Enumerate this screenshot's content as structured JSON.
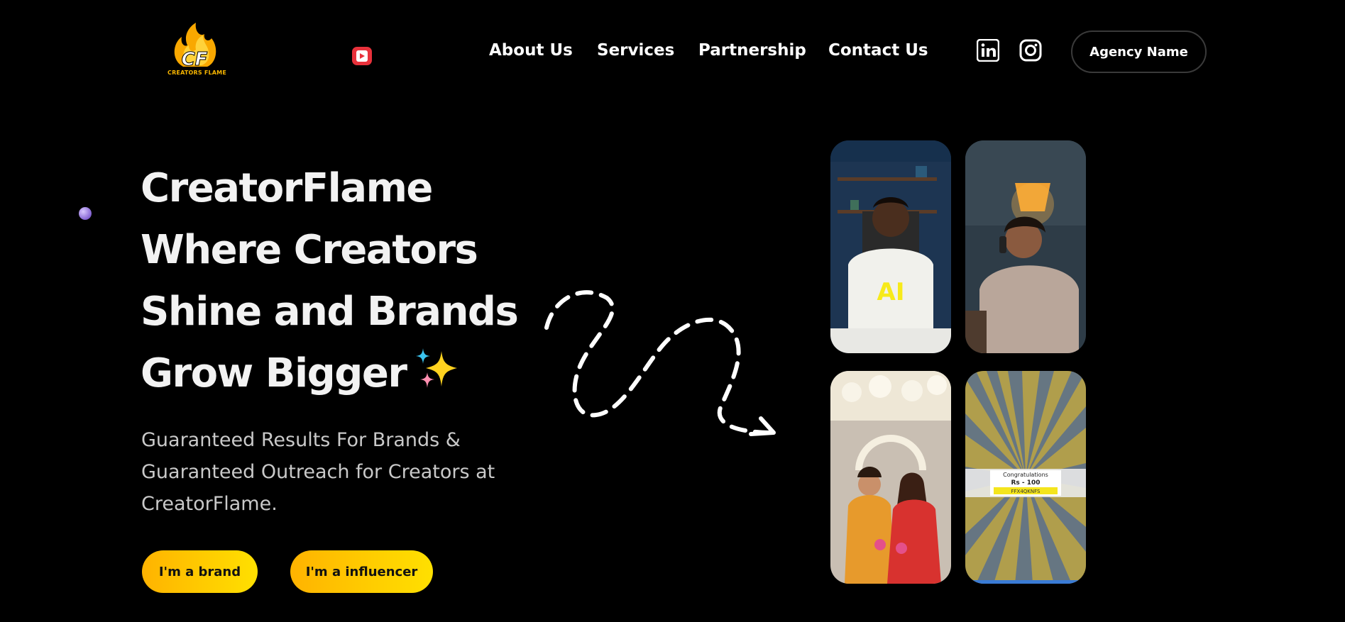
{
  "brand": {
    "logo_text": "CREATORS FLAME",
    "logo_letters": "CF",
    "accent_color": "#ffc400",
    "gradient_start": "#ffb300",
    "gradient_end": "#ffe000"
  },
  "header": {
    "nav": [
      {
        "label": "About Us"
      },
      {
        "label": "Services"
      },
      {
        "label": "Partnership"
      },
      {
        "label": "Contact Us"
      }
    ],
    "social_icons": [
      "linkedin-icon",
      "instagram-icon"
    ],
    "agency_button": "Agency Name"
  },
  "hero": {
    "headline_lines": [
      "CreatorFlame",
      "Where Creators",
      "Shine and Brands",
      "Grow Bigger"
    ],
    "sparkle_icon": "sparkles-icon",
    "subtext": "Guaranteed Results For Brands & Guaranteed Outreach for Creators at CreatorFlame.",
    "buttons": {
      "brand": "I'm a brand",
      "influencer": "I'm a influencer"
    }
  },
  "cards": [
    {
      "overlay": "AI"
    },
    {
      "overlay": ""
    },
    {
      "overlay": ""
    },
    {
      "overlay_lines": [
        "Congratulations",
        "Rs - 100",
        "FFX4QKNFS"
      ]
    }
  ]
}
